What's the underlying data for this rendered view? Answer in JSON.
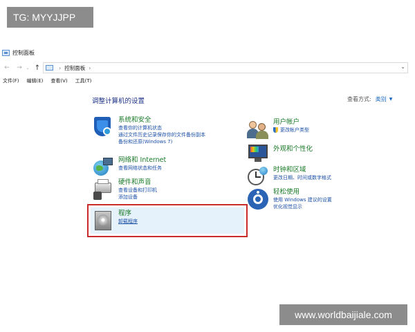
{
  "watermarks": {
    "top": "TG: MYYJJPP",
    "bottom": "www.worldbaijiale.com"
  },
  "window": {
    "title": "控制面板"
  },
  "address": {
    "path": "控制面板"
  },
  "menu": [
    "文件(F)",
    "编辑(E)",
    "查看(V)",
    "工具(T)"
  ],
  "content": {
    "heading": "调整计算机的设置",
    "view_by_label": "查看方式:",
    "view_by_value": "类别"
  },
  "categories": {
    "system": {
      "title": "系统和安全",
      "links": [
        "查看你的计算机状态",
        "通过文件历史记录保存你的文件备份副本",
        "备份和还原(Windows 7)"
      ],
      "icon": "shield-icon"
    },
    "network": {
      "title": "网络和 Internet",
      "links": [
        "查看网络状态和任务"
      ],
      "icon": "globe-network-icon"
    },
    "hardware": {
      "title": "硬件和声音",
      "links": [
        "查看设备和打印机",
        "添加设备"
      ],
      "icon": "printer-icon"
    },
    "programs": {
      "title": "程序",
      "links": [
        "卸载程序"
      ],
      "icon": "programs-icon"
    },
    "users": {
      "title": "用户帐户",
      "links": [
        "更改帐户类型"
      ],
      "icon": "users-icon"
    },
    "appearance": {
      "title": "外观和个性化",
      "links": [],
      "icon": "display-icon"
    },
    "clock": {
      "title": "时钟和区域",
      "links": [
        "更改日期、时间或数字格式"
      ],
      "icon": "clock-icon"
    },
    "ease": {
      "title": "轻松使用",
      "links": [
        "使用 Windows 建议的设置",
        "优化视觉显示"
      ],
      "icon": "ease-of-access-icon"
    }
  },
  "colors": {
    "category_title": "#1a7a28",
    "link": "#1a4fa8",
    "heading": "#1e3287",
    "highlight_border": "#c92b2b",
    "highlight_fill": "#e5f1fb"
  }
}
